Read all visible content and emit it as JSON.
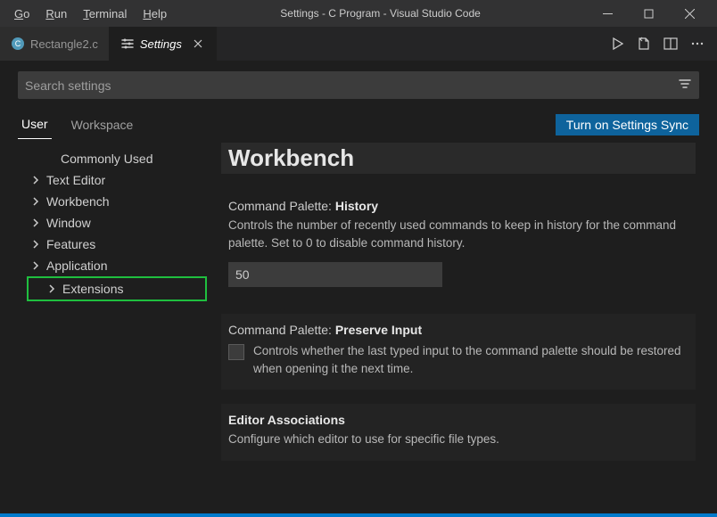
{
  "window": {
    "title": "Settings - C Program - Visual Studio Code"
  },
  "menu": {
    "go": "Go",
    "run": "Run",
    "terminal": "Terminal",
    "help": "Help"
  },
  "tabs": {
    "file": "Rectangle2.c",
    "settings": "Settings"
  },
  "search": {
    "placeholder": "Search settings"
  },
  "scope": {
    "user": "User",
    "workspace": "Workspace",
    "sync": "Turn on Settings Sync"
  },
  "tree": {
    "commonly_used": "Commonly Used",
    "text_editor": "Text Editor",
    "workbench": "Workbench",
    "window": "Window",
    "features": "Features",
    "application": "Application",
    "extensions": "Extensions"
  },
  "content": {
    "section_title": "Workbench",
    "history": {
      "label_scope": "Command Palette:",
      "label_name": "History",
      "desc": "Controls the number of recently used commands to keep in history for the command palette. Set to 0 to disable command history.",
      "value": "50"
    },
    "preserve": {
      "label_scope": "Command Palette:",
      "label_name": "Preserve Input",
      "desc": "Controls whether the last typed input to the command palette should be restored when opening it the next time."
    },
    "assoc": {
      "label_name": "Editor Associations",
      "desc": "Configure which editor to use for specific file types."
    }
  }
}
